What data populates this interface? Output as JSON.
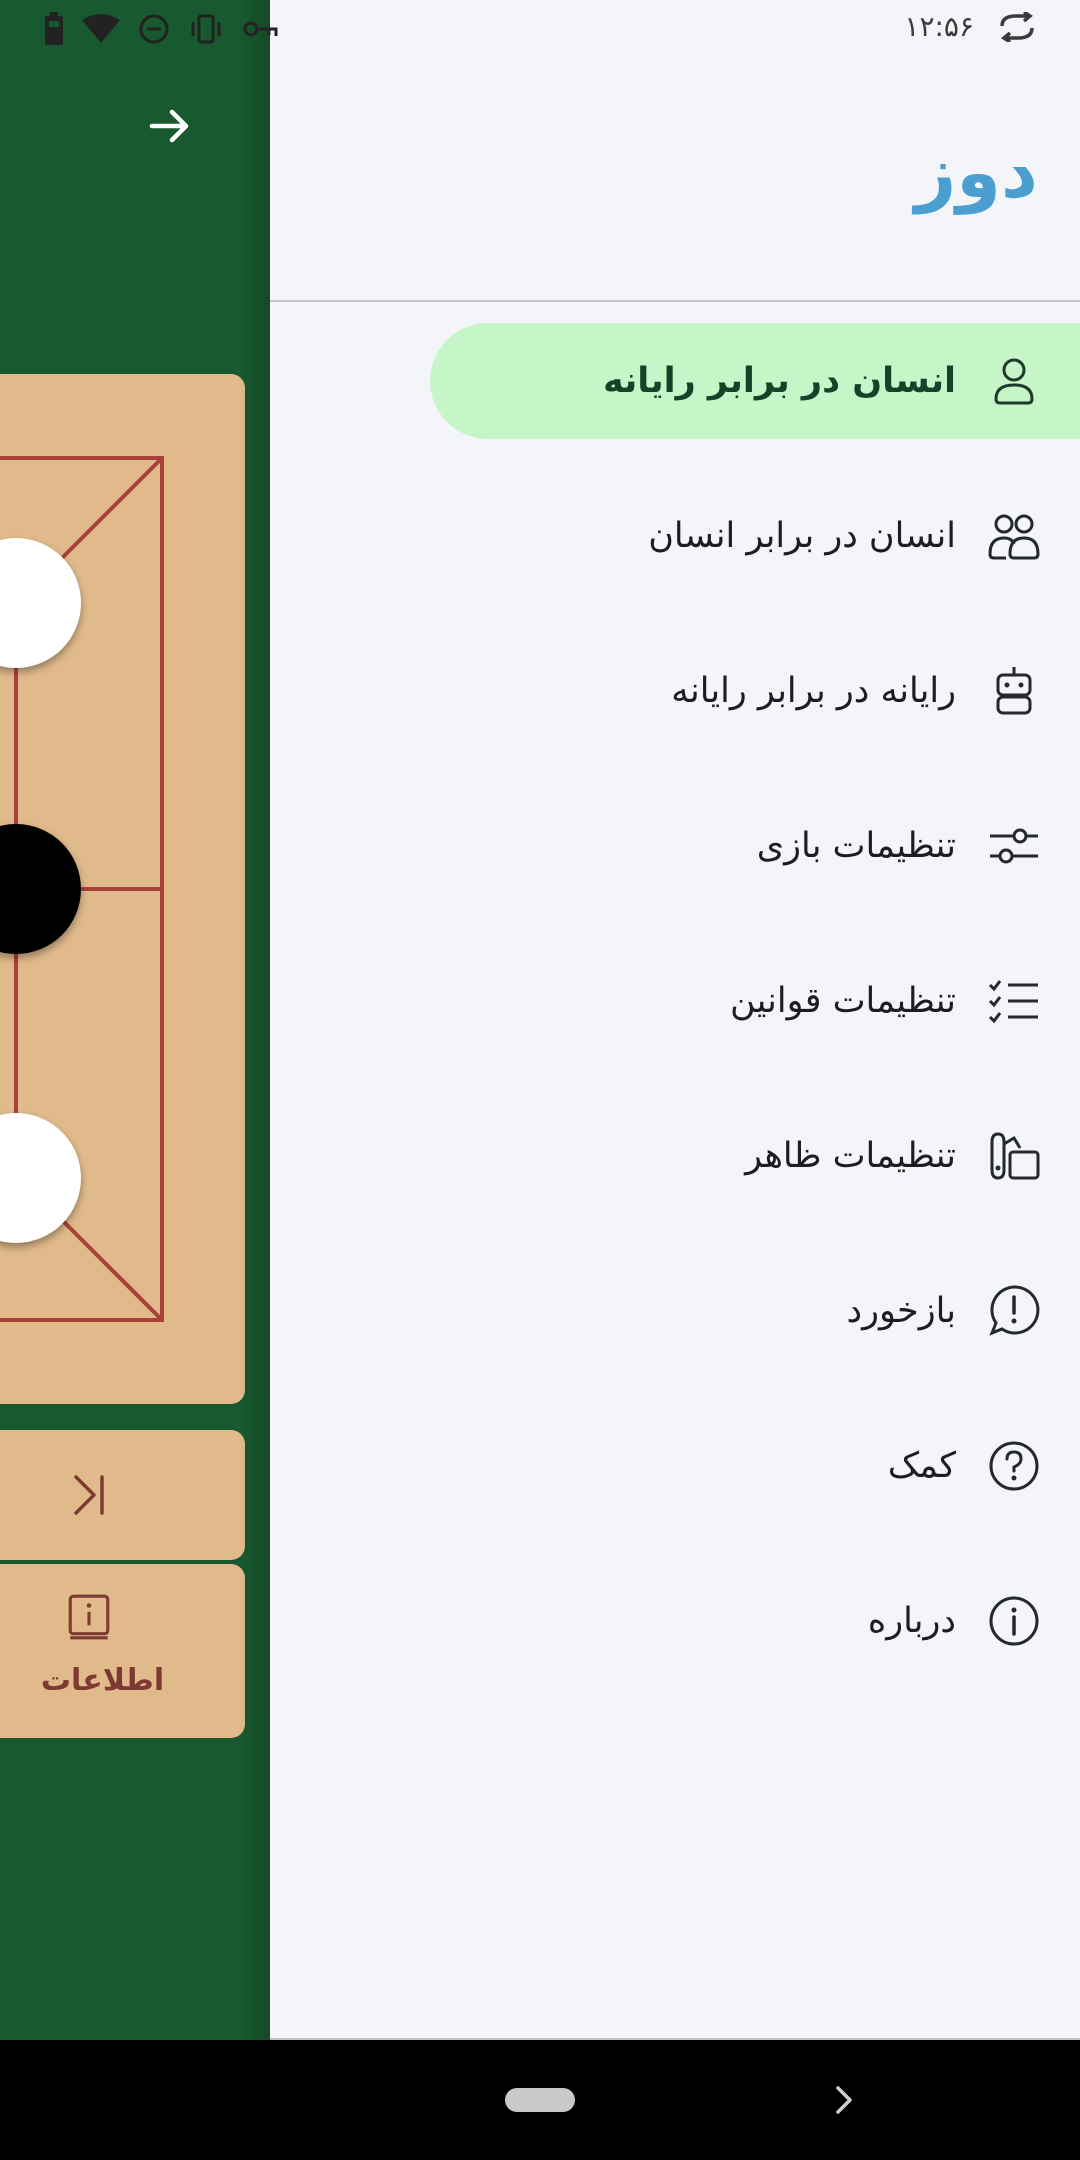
{
  "status_bar": {
    "time": "۱۲:۵۶",
    "icons": [
      "battery-icon",
      "wifi-icon",
      "dnd-icon",
      "vibrate-icon",
      "vpn-key-icon",
      "sync-icon"
    ]
  },
  "game": {
    "info_label": "اطلاعات",
    "pieces": [
      "white",
      "black",
      "white"
    ],
    "board_line_color": "#a8413a",
    "board_color": "#e0ba8b",
    "background_color": "#18592f"
  },
  "drawer": {
    "title": "دوز",
    "title_color": "#4a9ed0",
    "active_color": "#c6f6c8",
    "items": [
      {
        "label": "انسان در برابر رایانه",
        "icon": "person-icon",
        "active": true
      },
      {
        "label": "انسان در برابر انسان",
        "icon": "people-icon",
        "active": false
      },
      {
        "label": "رایانه در برابر رایانه",
        "icon": "robot-icon",
        "active": false
      },
      {
        "label": "تنظیمات بازی",
        "icon": "sliders-icon",
        "active": false
      },
      {
        "label": "تنظیمات قوانین",
        "icon": "checklist-icon",
        "active": false
      },
      {
        "label": "تنظیمات ظاهر",
        "icon": "appearance-icon",
        "active": false
      },
      {
        "label": "بازخورد",
        "icon": "feedback-icon",
        "active": false
      },
      {
        "label": "کمک",
        "icon": "help-icon",
        "active": false
      },
      {
        "label": "درباره",
        "icon": "info-icon",
        "active": false
      }
    ]
  }
}
